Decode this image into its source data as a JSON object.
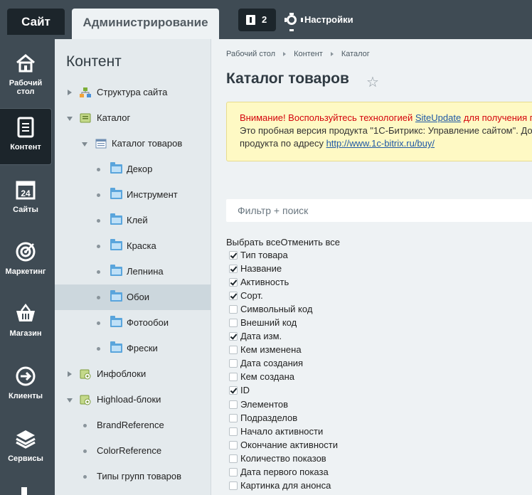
{
  "topbar": {
    "tab_site": "Сайт",
    "tab_admin": "Администрирование",
    "notifications_count": "2",
    "settings": "Настройки"
  },
  "rail": {
    "items": [
      {
        "label": "Рабочий стол",
        "icon": "home-icon"
      },
      {
        "label": "Контент",
        "icon": "document-icon",
        "active": true
      },
      {
        "label": "Сайты",
        "icon": "calendar-icon"
      },
      {
        "label": "Маркетинг",
        "icon": "target-icon"
      },
      {
        "label": "Магазин",
        "icon": "basket-icon"
      },
      {
        "label": "Клиенты",
        "icon": "arrow-circle-icon"
      },
      {
        "label": "Сервисы",
        "icon": "layers-icon"
      }
    ]
  },
  "tree": {
    "title": "Контент",
    "nodes": [
      {
        "label": "Структура сайта"
      },
      {
        "label": "Каталог"
      },
      {
        "label": "Каталог товаров"
      },
      {
        "label": "Декор"
      },
      {
        "label": "Инструмент"
      },
      {
        "label": "Клей"
      },
      {
        "label": "Краска"
      },
      {
        "label": "Лепнина"
      },
      {
        "label": "Обои",
        "selected": true
      },
      {
        "label": "Фотообои"
      },
      {
        "label": "Фрески"
      },
      {
        "label": "Инфоблоки"
      },
      {
        "label": "Highload-блоки"
      },
      {
        "label": "BrandReference"
      },
      {
        "label": "ColorReference"
      },
      {
        "label": "Типы групп товаров"
      }
    ]
  },
  "main": {
    "breadcrumbs": [
      "Рабочий стол",
      "Контент",
      "Каталог"
    ],
    "title": "Каталог товаров",
    "alert": {
      "warn_prefix": "Внимание! Воспользуйтесь технологией ",
      "link1": "SiteUpdate",
      "warn_suffix": " для получения п",
      "line2": "Это пробная версия продукта \"1С-Битрикс: Управление сайтом\". До",
      "line3_prefix": "продукта по адресу ",
      "link2": "http://www.1c-bitrix.ru/buy/"
    },
    "filter_placeholder": "Фильтр + поиск",
    "select_all": "Выбрать все",
    "deselect_all": "Отменить все",
    "fields": [
      {
        "label": "Тип товара",
        "checked": true
      },
      {
        "label": "Название",
        "checked": true
      },
      {
        "label": "Активность",
        "checked": true
      },
      {
        "label": "Сорт.",
        "checked": true
      },
      {
        "label": "Символьный код",
        "checked": false
      },
      {
        "label": "Внешний код",
        "checked": false
      },
      {
        "label": "Дата изм.",
        "checked": true
      },
      {
        "label": "Кем изменена",
        "checked": false
      },
      {
        "label": "Дата создания",
        "checked": false
      },
      {
        "label": "Кем создана",
        "checked": false
      },
      {
        "label": "ID",
        "checked": true
      },
      {
        "label": "Элементов",
        "checked": false
      },
      {
        "label": "Подразделов",
        "checked": false
      },
      {
        "label": "Начало активности",
        "checked": false
      },
      {
        "label": "Окончание активности",
        "checked": false
      },
      {
        "label": "Количество показов",
        "checked": false
      },
      {
        "label": "Дата первого показа",
        "checked": false
      },
      {
        "label": "Картинка для анонса",
        "checked": false
      }
    ]
  },
  "colors": {
    "dark_panel": "#3f4b54",
    "active_tab": "#1c252b",
    "warning_text": "#d4040b",
    "link": "#1e58a4",
    "folder": "#5aa5dc"
  }
}
